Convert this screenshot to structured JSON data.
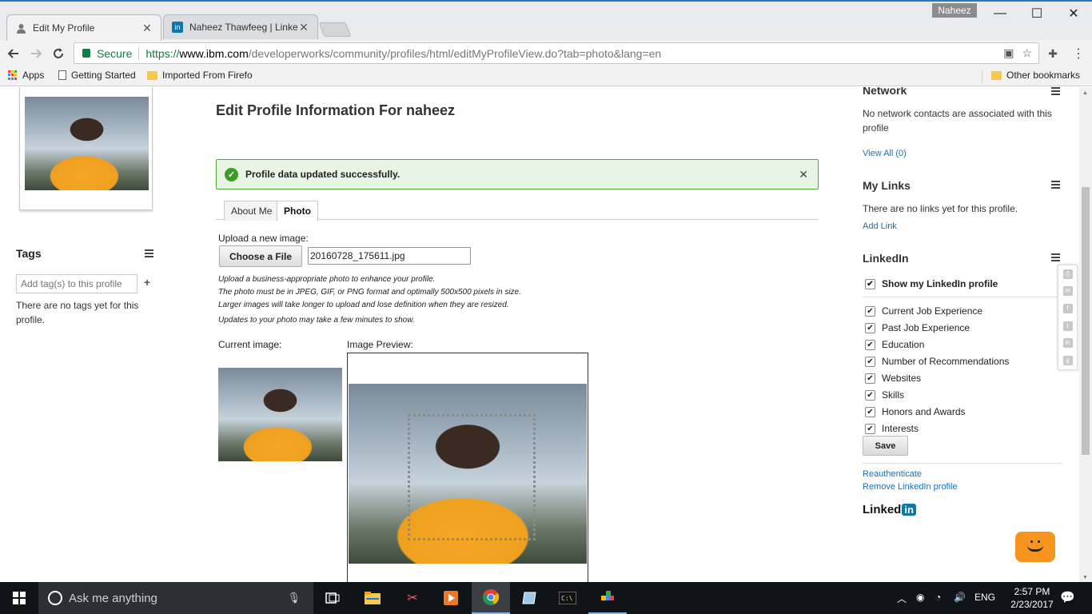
{
  "browser": {
    "tabs": [
      {
        "label": "Edit My Profile",
        "close": "✕"
      },
      {
        "label": "Naheez Thawfeeg | Linke",
        "close": "✕"
      }
    ],
    "profile_name": "Naheez",
    "window_controls": {
      "minimize": "—",
      "maximize": "☐",
      "close": "✕"
    },
    "secure_label": "Secure",
    "url_scheme": "https://",
    "url_host": "www.ibm.com",
    "url_path": "/developerworks/community/profiles/html/editMyProfileView.do?tab=photo&lang=en",
    "bookmarks": {
      "apps": "Apps",
      "getting_started": "Getting Started",
      "imported": "Imported From Firefo",
      "other": "Other bookmarks"
    }
  },
  "left": {
    "tags_title": "Tags",
    "tag_placeholder": "Add tag(s) to this profile",
    "tag_add": "+",
    "no_tags": "There are no tags yet for this profile."
  },
  "main": {
    "title": "Edit Profile Information For naheez",
    "success_msg": "Profile data updated successfully.",
    "success_close": "✕",
    "tabs": [
      "About Me",
      "Photo"
    ],
    "upload_label": "Upload a new image:",
    "choose_button": "Choose a File",
    "file_name": "20160728_175611.jpg",
    "hints": [
      "Upload a business-appropriate photo to enhance your profile.",
      "The photo must be in JPEG, GIF, or PNG format and optimally 500x500 pixels in size.",
      "Larger images will take longer to upload and lose definition when they are resized."
    ],
    "hint_update": "Updates to your photo may take a few minutes to show.",
    "current_label": "Current image:",
    "preview_label": "Image Preview:"
  },
  "right": {
    "network": {
      "title": "Network",
      "text": "No network contacts are associated with this profile",
      "link": "View All (0)"
    },
    "links": {
      "title": "My Links",
      "text": "There are no links yet for this profile.",
      "link": "Add Link"
    },
    "linkedin": {
      "title": "LinkedIn",
      "show_profile": "Show my LinkedIn profile",
      "options": [
        "Current Job Experience",
        "Past Job Experience",
        "Education",
        "Number of Recommendations",
        "Websites",
        "Skills",
        "Honors and Awards",
        "Interests"
      ],
      "save": "Save",
      "reauth": "Reauthenticate",
      "remove": "Remove LinkedIn profile",
      "logo_text": "Linked",
      "logo_in": "in"
    }
  },
  "taskbar": {
    "search_placeholder": "Ask me anything",
    "language": "ENG",
    "time": "2:57 PM",
    "date": "2/23/2017"
  }
}
